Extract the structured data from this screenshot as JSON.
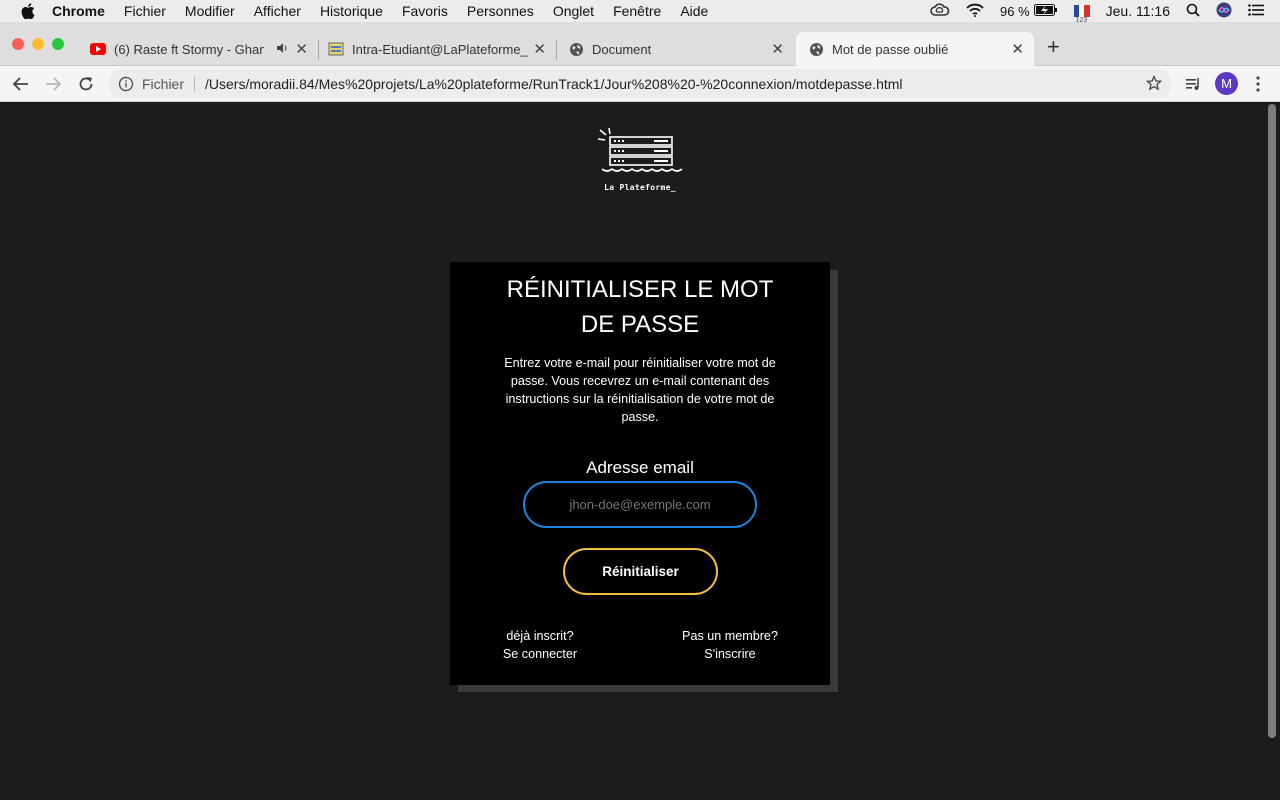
{
  "menubar": {
    "app_name": "Chrome",
    "items": [
      "Fichier",
      "Modifier",
      "Afficher",
      "Historique",
      "Favoris",
      "Personnes",
      "Onglet",
      "Fenêtre",
      "Aide"
    ],
    "battery": "96 %",
    "input_source_num": "123",
    "clock": "Jeu. 11:16"
  },
  "tabs": [
    {
      "title": "(6) Raste ft Stormy - Ghan",
      "icon": "youtube-icon",
      "active": false
    },
    {
      "title": "Intra-Etudiant@LaPlateforme_",
      "icon": "intra-icon",
      "active": false
    },
    {
      "title": "Document",
      "icon": "globe-icon",
      "active": false
    },
    {
      "title": "Mot de passe oublié",
      "icon": "globe-icon",
      "active": true
    }
  ],
  "toolbar": {
    "scheme_label": "Fichier",
    "url": "/Users/moradii.84/Mes%20projets/La%20plateforme/RunTrack1/Jour%208%20-%20connexion/motdepasse.html",
    "avatar_letter": "M"
  },
  "page": {
    "logo_text": "La Plateforme_",
    "title": "RÉINITIALISER LE MOT DE PASSE",
    "description": "Entrez votre e-mail pour réinitialiser votre mot de passe. Vous recevrez un e-mail contenant des instructions sur la réinitialisation de votre mot de passe.",
    "email_label": "Adresse email",
    "email_placeholder": "jhon-doe@exemple.com",
    "email_value": "",
    "submit_label": "Réinitialiser",
    "login_link": {
      "line1": "déjà inscrit?",
      "line2": "Se connecter"
    },
    "signup_link": {
      "line1": "Pas un membre?",
      "line2": "S'inscrire"
    }
  },
  "colors": {
    "page_bg": "#1c1c1c",
    "card_bg": "#000000",
    "input_border": "#1c84de",
    "button_border": "#f2be3c",
    "avatar_bg": "#5b39c6"
  }
}
